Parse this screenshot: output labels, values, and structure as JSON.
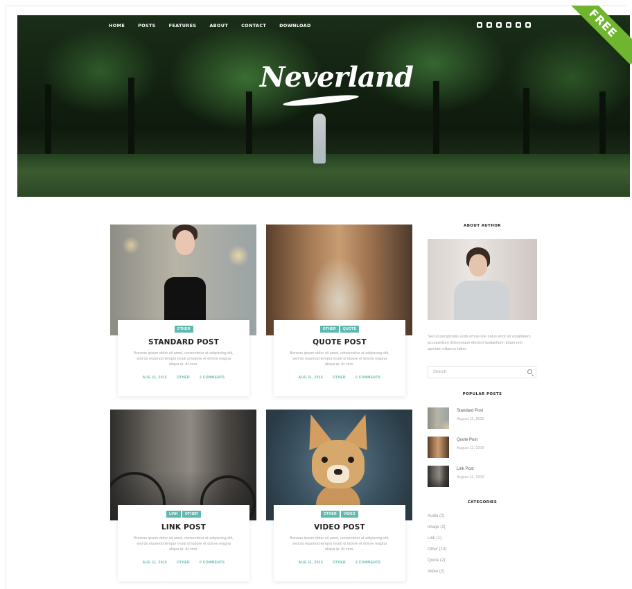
{
  "nav": [
    "HOME",
    "POSTS",
    "FEATURES",
    "ABOUT",
    "CONTACT",
    "DOWNLOAD"
  ],
  "social_icons": [
    "facebook-icon",
    "google-plus-icon",
    "instagram-icon",
    "pinterest-icon",
    "twitter-icon",
    "youtube-icon"
  ],
  "logo": "Neverland",
  "ribbon": "FREE",
  "accent_color": "#5fb9ae",
  "ribbon_color": "#6fb52f",
  "posts": [
    {
      "title": "STANDARD POST",
      "tags": [
        "OTHER"
      ],
      "excerpt": "Bonean ipsum dolor sit amet, consectetur at adipiscing elit, sed do eiusmod tempor incidi ut labore et dolore magna aliqua ip. At vero.",
      "date": "AUG 11, 2015",
      "category": "OTHER",
      "comments": "2 COMMENTS"
    },
    {
      "title": "QUOTE POST",
      "tags": [
        "OTHER",
        "QUOTE"
      ],
      "excerpt": "Bonean ipsum dolor sit amet, consectetur at adipiscing elit, sed do eiusmod tempor incidi ut labore et dolore magna aliqua ip. At vero.",
      "date": "AUG 11, 2015",
      "category": "OTHER",
      "comments": "0 COMMENTS"
    },
    {
      "title": "LINK POST",
      "tags": [
        "LINK",
        "OTHER"
      ],
      "excerpt": "Bonean ipsum dolor sit amet, consectetur at adipiscing elit, sed do eiusmod tempor incidi ut labore et dolore magna aliqua ip. At vero.",
      "date": "AUG 11, 2015",
      "category": "OTHER",
      "comments": "0 COMMENTS"
    },
    {
      "title": "VIDEO POST",
      "tags": [
        "OTHER",
        "VIDEO"
      ],
      "excerpt": "Bonean ipsum dolor sit amet, consectetur at adipiscing elit, sed do eiusmod tempor incidi ut labore et dolore magna aliqua ip. At vero.",
      "date": "AUG 11, 2015",
      "category": "OTHER",
      "comments": "2 COMMENTS"
    }
  ],
  "sidebar": {
    "about_heading": "ABOUT AUTHOR",
    "about_text": "Sed ut perspiciatis unde omnis iste natus error sit voluptatem accusantium doloremque electrut laudantium, totam rem aperiam ulliamco labor.",
    "search_placeholder": "Search",
    "popular_heading": "POPULAR POSTS",
    "popular": [
      {
        "title": "Standard Post",
        "date": "August 11, 2015"
      },
      {
        "title": "Quote Post",
        "date": "August 11, 2015"
      },
      {
        "title": "Link Post",
        "date": "August 11, 2015"
      }
    ],
    "categories_heading": "CATEGORIES",
    "categories": [
      "Audio (2)",
      "Image (2)",
      "Link (1)",
      "Other (13)",
      "Quote (2)",
      "Video (2)"
    ]
  }
}
